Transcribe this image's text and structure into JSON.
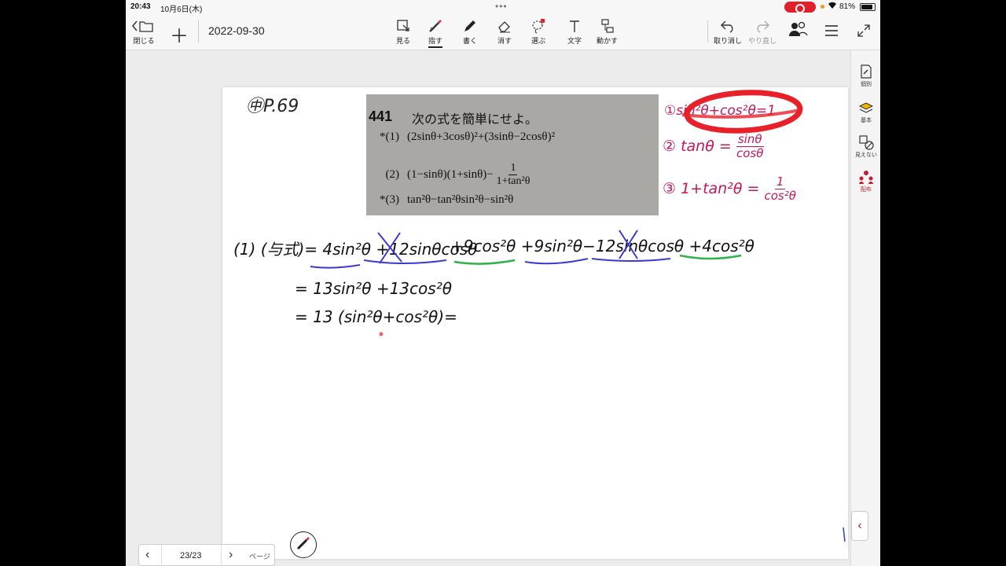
{
  "status": {
    "time": "20:43",
    "date": "10月6日(木)",
    "battery": "81%"
  },
  "toolbar": {
    "close_label": "閉じる",
    "title": "2022-09-30",
    "tools": {
      "view": "見る",
      "point": "指す",
      "write": "書く",
      "erase": "消す",
      "select": "選ぶ",
      "text": "文字",
      "move": "動かす"
    },
    "undo_label": "取り消し",
    "redo_label": "やり直し"
  },
  "right_panel": {
    "individual": "個別",
    "basic": "基本",
    "hidden": "見えない",
    "distribute": "配布"
  },
  "textbook": {
    "number": "441",
    "instruction": "次の式を簡単にせよ。",
    "problems": {
      "p1_no": "*(1)",
      "p1_expr": "(2sinθ+3cosθ)²+(3sinθ−2cosθ)²",
      "p2_no": "(2)",
      "p2_expr": "(1−sinθ)(1+sinθ)−",
      "p2_frac_num": "1",
      "p2_frac_den": "1+tan²θ",
      "p3_no": "*(3)",
      "p3_expr": "tan²θ−tan²θsin²θ−sin²θ"
    }
  },
  "handwriting": {
    "page_ref": "㊥P.69",
    "notes": {
      "n1": "①sin²θ+cos²θ=1",
      "n2": "② tanθ = ",
      "n2_num": "sinθ",
      "n2_den": "cosθ",
      "n3": "③ 1+tan²θ = ",
      "n3_num": "1",
      "n3_den": "cos²θ"
    },
    "work": {
      "line1a": "(1) (与式)= 4sin²θ +12sinθcosθ",
      "line1b": "+9cos²θ +9sin²θ−12sinθcosθ +4cos²θ",
      "line2": "= 13sin²θ +13cos²θ",
      "line3": "= 13 (sin²θ+cos²θ)="
    }
  },
  "colors": {
    "note_ink": "#c2185b",
    "highlight": "#e8202a",
    "underline_blue": "#3a3ad0",
    "underline_green": "#2db34a",
    "accent": "#c0202a"
  },
  "pager": {
    "count": "23/23",
    "label": "ページ"
  }
}
